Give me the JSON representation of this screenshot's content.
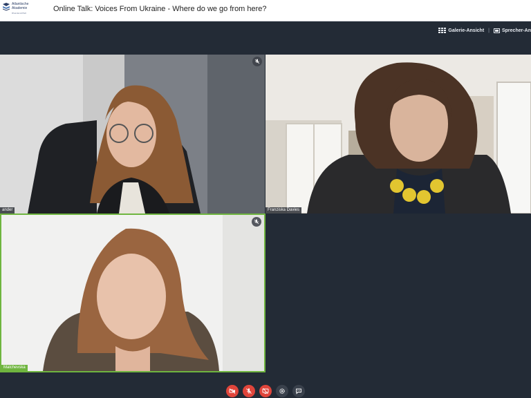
{
  "header": {
    "logo_line1": "Atlantische",
    "logo_line2": "Akademie",
    "logo_line3": "Rheinland-Pfalz",
    "title": "Online Talk: Voices From Ukraine - Where do we go from here?"
  },
  "view_options": {
    "gallery": "Galerie-Ansicht",
    "separator": "|",
    "speaker": "Sprecher-An"
  },
  "participants": [
    {
      "name": "ander",
      "muted": true,
      "speaking": false
    },
    {
      "name": "Franziska Davies",
      "muted": false,
      "speaking": false
    },
    {
      "name": "Malchevska",
      "muted": true,
      "speaking": true
    }
  ],
  "controls": [
    {
      "icon": "camera-icon",
      "state": "off"
    },
    {
      "icon": "microphone-muted-icon",
      "state": "off"
    },
    {
      "icon": "screen-share-icon",
      "state": "off"
    },
    {
      "icon": "gear-icon",
      "state": "neutral"
    },
    {
      "icon": "chat-icon",
      "state": "neutral"
    }
  ],
  "colors": {
    "stage_background": "#232b36",
    "active_speaker": "#6fb53f",
    "control_off": "#e0453b",
    "control_neutral": "#3a414c"
  }
}
